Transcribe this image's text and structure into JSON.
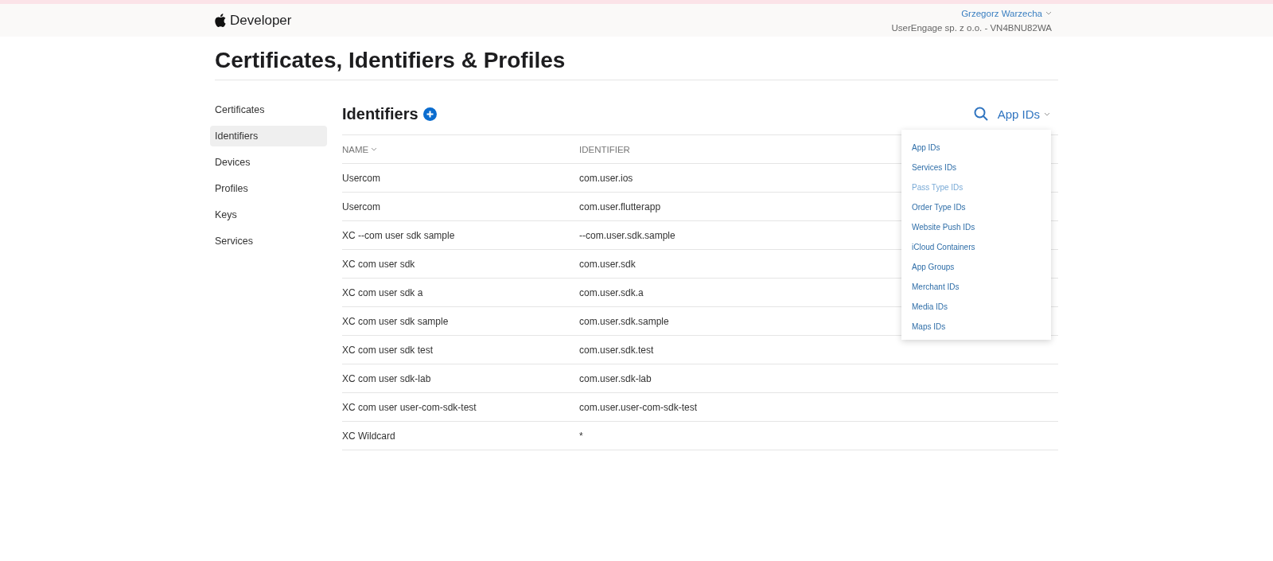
{
  "header": {
    "brand": "Developer",
    "user": "Grzegorz Warzecha",
    "team": "UserEngage sp. z o.o. - VN4BNU82WA"
  },
  "page_title": "Certificates, Identifiers & Profiles",
  "sidebar": {
    "items": [
      {
        "label": "Certificates",
        "selected": false
      },
      {
        "label": "Identifiers",
        "selected": true
      },
      {
        "label": "Devices",
        "selected": false
      },
      {
        "label": "Profiles",
        "selected": false
      },
      {
        "label": "Keys",
        "selected": false
      },
      {
        "label": "Services",
        "selected": false
      }
    ]
  },
  "section_title": "Identifiers",
  "filter": {
    "label": "App IDs",
    "expanded": true,
    "options": [
      {
        "label": "App IDs",
        "hovered": false
      },
      {
        "label": "Services IDs",
        "hovered": false
      },
      {
        "label": "Pass Type IDs",
        "hovered": true
      },
      {
        "label": "Order Type IDs",
        "hovered": false
      },
      {
        "label": "Website Push IDs",
        "hovered": false
      },
      {
        "label": "iCloud Containers",
        "hovered": false
      },
      {
        "label": "App Groups",
        "hovered": false
      },
      {
        "label": "Merchant IDs",
        "hovered": false
      },
      {
        "label": "Media IDs",
        "hovered": false
      },
      {
        "label": "Maps IDs",
        "hovered": false
      }
    ]
  },
  "table": {
    "columns": [
      "NAME",
      "IDENTIFIER"
    ],
    "rows": [
      [
        "Usercom",
        "com.user.ios"
      ],
      [
        "Usercom",
        "com.user.flutterapp"
      ],
      [
        "XC --com user sdk sample",
        "--com.user.sdk.sample"
      ],
      [
        "XC com user sdk",
        "com.user.sdk"
      ],
      [
        "XC com user sdk a",
        "com.user.sdk.a"
      ],
      [
        "XC com user sdk sample",
        "com.user.sdk.sample"
      ],
      [
        "XC com user sdk test",
        "com.user.sdk.test"
      ],
      [
        "XC com user sdk-lab",
        "com.user.sdk-lab"
      ],
      [
        "XC com user user-com-sdk-test",
        "com.user.user-com-sdk-test"
      ],
      [
        "XC Wildcard",
        "*"
      ]
    ]
  }
}
